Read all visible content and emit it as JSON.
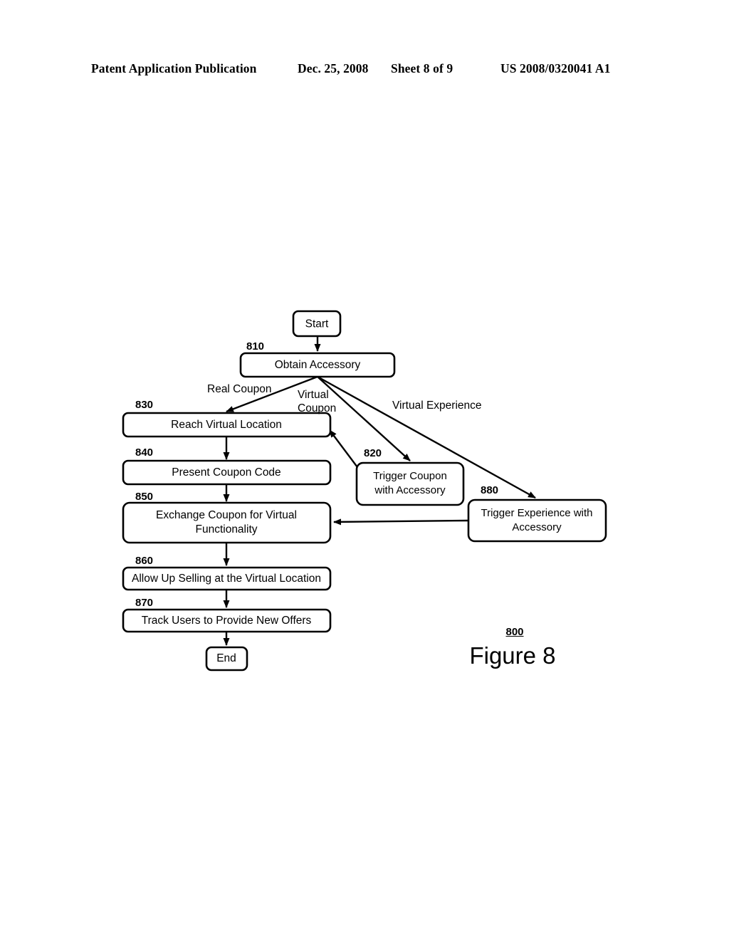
{
  "header": {
    "publication": "Patent Application Publication",
    "date": "Dec. 25, 2008",
    "sheet": "Sheet 8 of 9",
    "patent_number": "US 2008/0320041 A1"
  },
  "figure": {
    "caption_ref": "800",
    "caption_title": "Figure 8"
  },
  "diagram": {
    "type": "flowchart",
    "nodes": [
      {
        "id": "start",
        "ref": "",
        "label": "Start",
        "line1": "Start",
        "line2": ""
      },
      {
        "id": "n810",
        "ref": "810",
        "label": "Obtain Accessory",
        "line1": "Obtain Accessory",
        "line2": ""
      },
      {
        "id": "n830",
        "ref": "830",
        "label": "Reach Virtual Location",
        "line1": "Reach Virtual Location",
        "line2": ""
      },
      {
        "id": "n840",
        "ref": "840",
        "label": "Present Coupon Code",
        "line1": "Present Coupon Code",
        "line2": ""
      },
      {
        "id": "n850",
        "ref": "850",
        "label": "Exchange Coupon for Virtual Functionality",
        "line1": "Exchange Coupon for Virtual",
        "line2": "Functionality"
      },
      {
        "id": "n860",
        "ref": "860",
        "label": "Allow Up Selling at the Virtual Location",
        "line1": "Allow Up Selling at the Virtual Location",
        "line2": ""
      },
      {
        "id": "n870",
        "ref": "870",
        "label": "Track Users to Provide New Offers",
        "line1": "Track Users to Provide New Offers",
        "line2": ""
      },
      {
        "id": "end",
        "ref": "",
        "label": "End",
        "line1": "End",
        "line2": ""
      },
      {
        "id": "n820",
        "ref": "820",
        "label": "Trigger Coupon with Accessory",
        "line1": "Trigger Coupon",
        "line2": "with Accessory"
      },
      {
        "id": "n880",
        "ref": "880",
        "label": "Trigger Experience with Accessory",
        "line1": "Trigger Experience with",
        "line2": "Accessory"
      }
    ],
    "edge_labels": [
      {
        "id": "real-coupon",
        "line1": "Real Coupon",
        "line2": ""
      },
      {
        "id": "virtual-coupon",
        "line1": "Virtual",
        "line2": "Coupon"
      },
      {
        "id": "virtual-experience",
        "line1": "Virtual Experience",
        "line2": ""
      }
    ],
    "edges": [
      {
        "from": "start",
        "to": "n810",
        "label": ""
      },
      {
        "from": "n810",
        "to": "n830",
        "label": "Real Coupon"
      },
      {
        "from": "n810",
        "to": "n820",
        "label": "Virtual Coupon"
      },
      {
        "from": "n810",
        "to": "n880",
        "label": "Virtual Experience"
      },
      {
        "from": "n820",
        "to": "n830",
        "label": ""
      },
      {
        "from": "n830",
        "to": "n840",
        "label": ""
      },
      {
        "from": "n840",
        "to": "n850",
        "label": ""
      },
      {
        "from": "n880",
        "to": "n850",
        "label": ""
      },
      {
        "from": "n850",
        "to": "n860",
        "label": ""
      },
      {
        "from": "n860",
        "to": "n870",
        "label": ""
      },
      {
        "from": "n870",
        "to": "end",
        "label": ""
      }
    ]
  }
}
